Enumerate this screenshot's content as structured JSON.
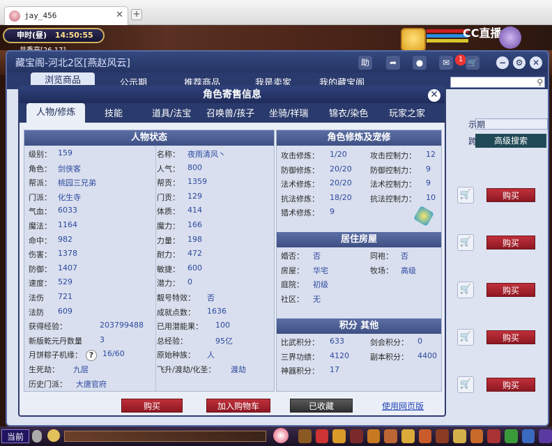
{
  "browser": {
    "tab_title": "jay_456",
    "tab_close": "✕",
    "new_tab": "+"
  },
  "game": {
    "clock_label": "申时(昼)",
    "clock_time": "14:50:55",
    "coord": "共香亭[26,17]",
    "cc_logo": "CC直播",
    "current_channel": "当前"
  },
  "shop": {
    "title": "藏宝阁-河北2区[燕赵风云]",
    "title_help": "助",
    "badge_count": "1",
    "nav": [
      "浏览商品",
      "公示期",
      "推荐商品",
      "我是卖家",
      "我的藏宝阁"
    ],
    "right_label_1": "示期",
    "right_label_2": "跨服",
    "advanced_search": "高级搜索",
    "buy_label": "购买"
  },
  "modal": {
    "title": "角色寄售信息",
    "close": "✕",
    "tabs": [
      "人物/修炼",
      "技能",
      "道具/法宝",
      "召唤兽/孩子",
      "坐骑/祥瑞",
      "锦衣/染色",
      "玩家之家"
    ],
    "left_header": "人物状态",
    "left_col1": [
      {
        "k": "级别：",
        "v": "159"
      },
      {
        "k": "角色：",
        "v": "剑侠客"
      },
      {
        "k": "帮派：",
        "v": "桃园三兄弟"
      },
      {
        "k": "门派：",
        "v": "化生寺"
      },
      {
        "k": "气血：",
        "v": "6033"
      },
      {
        "k": "魔法：",
        "v": "1164"
      },
      {
        "k": "命中：",
        "v": "982"
      },
      {
        "k": "伤害：",
        "v": "1378"
      },
      {
        "k": "防御：",
        "v": "1407"
      },
      {
        "k": "速度：",
        "v": "529"
      },
      {
        "k": "法伤",
        "v": "721"
      },
      {
        "k": "法防",
        "v": "609"
      },
      {
        "k": "获得经验：",
        "v": "203799488"
      },
      {
        "k": "新版乾元丹数量",
        "v": "3"
      },
      {
        "k": "月饼粽子机缘：",
        "v": "16/60"
      },
      {
        "k": "生死劫：",
        "v": "九层"
      },
      {
        "k": "历史门派：",
        "v": "大唐官府"
      }
    ],
    "left_col2": [
      {
        "k": "名称：",
        "v": "夜雨清风丶"
      },
      {
        "k": "人气：",
        "v": "800"
      },
      {
        "k": "帮贡：",
        "v": "1359"
      },
      {
        "k": "门贡：",
        "v": "129"
      },
      {
        "k": "体质：",
        "v": "414"
      },
      {
        "k": "魔力：",
        "v": "166"
      },
      {
        "k": "力量：",
        "v": "198"
      },
      {
        "k": "耐力：",
        "v": "472"
      },
      {
        "k": "敏捷：",
        "v": "600"
      },
      {
        "k": "潜力：",
        "v": "0"
      },
      {
        "k": "靓号特效：",
        "v": "否"
      },
      {
        "k": "成就点数：",
        "v": "1636"
      },
      {
        "k": "已用潜能果：",
        "v": "100"
      },
      {
        "k": "总经验：",
        "v": "95亿"
      },
      {
        "k": "原始种族：",
        "v": "人"
      },
      {
        "k": "飞升/渡劫/化圣：",
        "v": "渡劫"
      }
    ],
    "help_mark": "?",
    "right_header_1": "角色修炼及宠修",
    "cultivation": [
      {
        "k": "攻击修炼：",
        "v": "1/20",
        "k2": "攻击控制力：",
        "v2": "12"
      },
      {
        "k": "防御修炼：",
        "v": "20/20",
        "k2": "防御控制力：",
        "v2": "9"
      },
      {
        "k": "法术修炼：",
        "v": "20/20",
        "k2": "法术控制力：",
        "v2": "9"
      },
      {
        "k": "抗法修炼：",
        "v": "18/20",
        "k2": "抗法控制力：",
        "v2": "10"
      },
      {
        "k": "猎术修炼：",
        "v": "9",
        "k2": "",
        "v2": ""
      }
    ],
    "right_header_2": "居住房屋",
    "house": [
      {
        "k": "婚否：",
        "v": "否",
        "k2": "同袍：",
        "v2": "否"
      },
      {
        "k": "房屋：",
        "v": "华宅",
        "k2": "牧场：",
        "v2": "高级"
      },
      {
        "k": "庭院：",
        "v": "初级",
        "k2": "",
        "v2": ""
      },
      {
        "k": "社区：",
        "v": "无",
        "k2": "",
        "v2": ""
      }
    ],
    "right_header_3": "积分 其他",
    "points": [
      {
        "k": "比武积分：",
        "v": "633",
        "k2": "剑会积分：",
        "v2": "0"
      },
      {
        "k": "三界功绩：",
        "v": "4120",
        "k2": "副本积分：",
        "v2": "4400"
      },
      {
        "k": "神器积分：",
        "v": "17",
        "k2": "",
        "v2": ""
      }
    ],
    "btn_buy": "购买",
    "btn_add_cart": "加入购物车",
    "btn_collected": "已收藏",
    "link_web": "使用网页版"
  }
}
